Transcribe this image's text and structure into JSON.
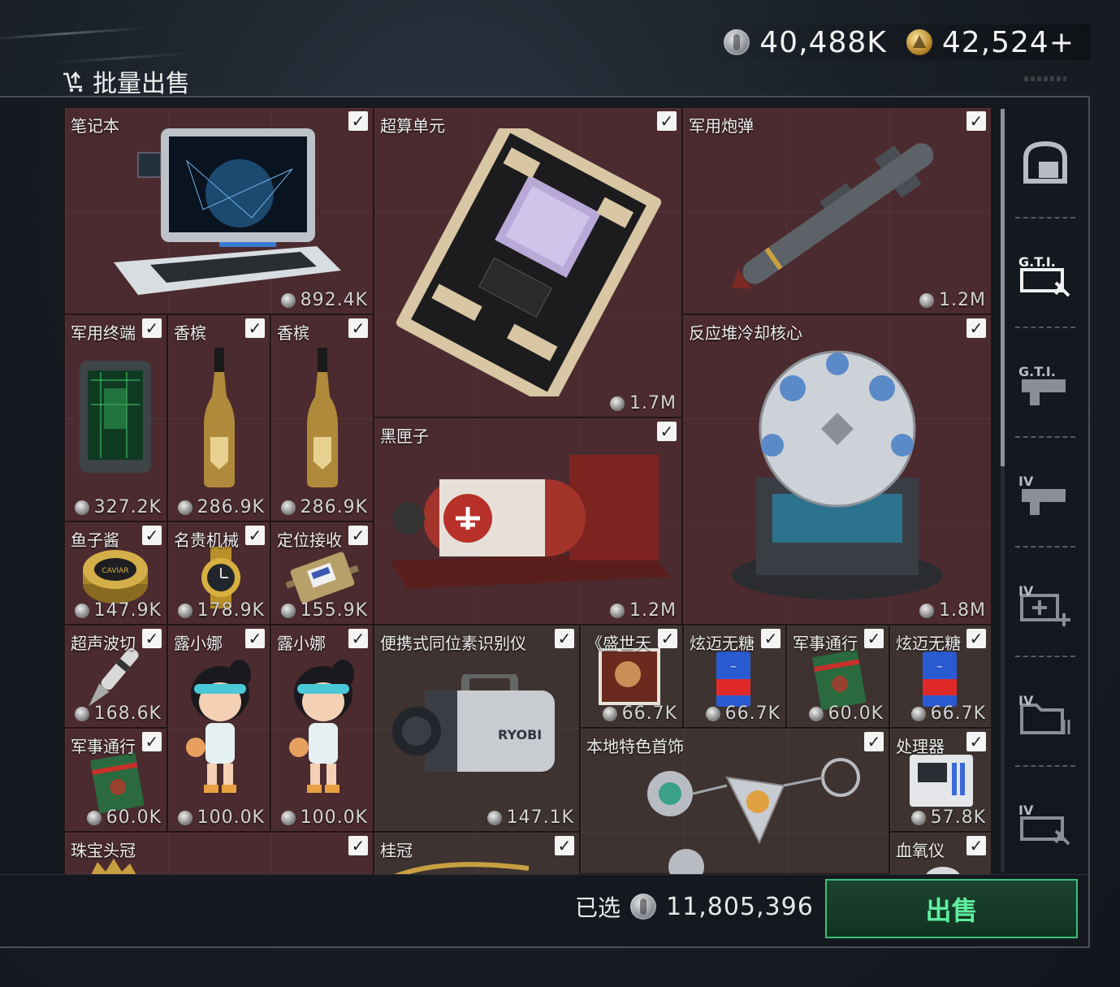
{
  "header": {
    "title": "批量出售",
    "title_icon": "cart-upload-icon",
    "currency_silver": "40,488K",
    "currency_gold": "42,524+"
  },
  "items": [
    {
      "name": "笔记本",
      "price": "892.4K",
      "checked": true
    },
    {
      "name": "超算单元",
      "price": "1.7M",
      "checked": true
    },
    {
      "name": "军用炮弹",
      "price": "1.2M",
      "checked": true
    },
    {
      "name": "军用终端",
      "price": "327.2K",
      "checked": true
    },
    {
      "name": "香槟",
      "price": "286.9K",
      "checked": true
    },
    {
      "name": "香槟",
      "price": "286.9K",
      "checked": true
    },
    {
      "name": "反应堆冷却核心",
      "price": "1.8M",
      "checked": true
    },
    {
      "name": "黑匣子",
      "price": "1.2M",
      "checked": true
    },
    {
      "name": "鱼子酱",
      "price": "147.9K",
      "checked": true
    },
    {
      "name": "名贵机械",
      "price": "178.9K",
      "checked": true
    },
    {
      "name": "定位接收",
      "price": "155.9K",
      "checked": true
    },
    {
      "name": "超声波切",
      "price": "168.6K",
      "checked": true
    },
    {
      "name": "露小娜",
      "price": "100.0K",
      "checked": true
    },
    {
      "name": "露小娜",
      "price": "100.0K",
      "checked": true
    },
    {
      "name": "便携式同位素识别仪",
      "price": "147.1K",
      "checked": true
    },
    {
      "name": "《盛世天",
      "price": "66.7K",
      "checked": true
    },
    {
      "name": "炫迈无糖",
      "price": "66.7K",
      "checked": true
    },
    {
      "name": "军事通行",
      "price": "60.0K",
      "checked": true
    },
    {
      "name": "炫迈无糖",
      "price": "66.7K",
      "checked": true
    },
    {
      "name": "军事通行",
      "price": "60.0K",
      "checked": true
    },
    {
      "name": "本地特色首饰",
      "price": "",
      "checked": true
    },
    {
      "name": "处理器",
      "price": "57.8K",
      "checked": true
    },
    {
      "name": "珠宝头冠",
      "price": "",
      "checked": true
    },
    {
      "name": "桂冠",
      "price": "",
      "checked": true
    },
    {
      "name": "血氧仪",
      "price": "",
      "checked": true
    }
  ],
  "art_text": {
    "caviar": "CAVIAR",
    "ryobi": "RYOBI"
  },
  "sidebar": {
    "categories": [
      {
        "icon": "bag-icon",
        "label": ""
      },
      {
        "icon": "gti-repair-icon",
        "label": "G.T.I."
      },
      {
        "icon": "gti-weapon-icon",
        "label": "G.T.I."
      },
      {
        "icon": "iv-weapon-icon",
        "label": "IV"
      },
      {
        "icon": "iv-medkit-icon",
        "label": "IV"
      },
      {
        "icon": "iv-folder-icon",
        "label": "IV"
      },
      {
        "icon": "iv-tools-icon",
        "label": "IV"
      }
    ]
  },
  "footer": {
    "selected_label": "已选",
    "selected_amount": "11,805,396",
    "sell_label": "出售"
  }
}
